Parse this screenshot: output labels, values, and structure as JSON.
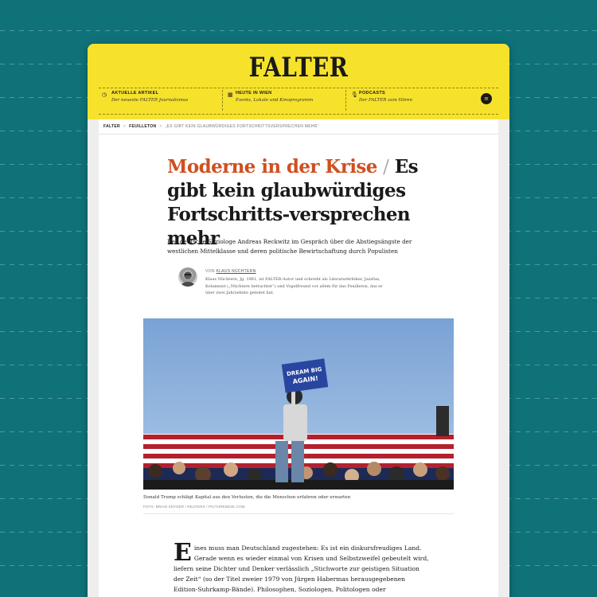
{
  "site": {
    "logo": "FALTER"
  },
  "nav": [
    {
      "icon": "clock-icon",
      "title": "Aktuelle Artikel",
      "subtitle": "Der neueste FALTER Journalismus"
    },
    {
      "icon": "calendar-icon",
      "title": "Heute in Wien",
      "subtitle": "Events, Lokale und Kinoprogramm"
    },
    {
      "icon": "microphone-icon",
      "title": "Podcasts",
      "subtitle": "Der FALTER zum Hören"
    }
  ],
  "menu_button_icon": "hamburger-icon",
  "breadcrumb": [
    "FALTER",
    "FEUILLETON",
    "„ES GIBT KEIN GLAUBWÜRDIGES FORTSCHRITTSVERSPRECHEN MEHR“"
  ],
  "article": {
    "kicker": "Moderne in der Krise",
    "title": "Es gibt kein glaubwürdiges Fortschritts-versprechen mehr",
    "lead": "Der deutsche Soziologe Andreas Reckwitz im Gespräch über die Abstiegsängste der westlichen Mittelklasse und deren politische Bewirtschaftung durch Populisten",
    "author_prefix": "VON",
    "author_name": "KLAUS NÜCHTERN",
    "author_bio": "Klaus Nüchtern, Jg. 1961, ist FALTER-Autor und schreibt als Literaturkritiker, Jazzfan, Kolumnist („Nüchtern betrachtet“) und Vogelfreund vor allem für das Feuilleton, das er über zwei Jahrzehnte geleitet hat.",
    "image_sign_line1": "DREAM BIG",
    "image_sign_line2": "AGAIN!",
    "caption": "Donald Trump schlägt Kapital aus den Verlusten, die die Menschen erfahren oder erwarten",
    "credit": "FOTO: BRIAN SNYDER / REUTERS / PICTUREDESK.COM",
    "dropcap": "E",
    "body": "ines muss man Deutschland zugestehen: Es ist ein diskursfreudiges Land. Gerade wenn es wieder einmal von Krisen und Selbstzweifel gebeutelt wird, liefern seine Dichter und Denker verlässlich „Stichworte zur geistigen Situation der Zeit“ (so der Titel zweier 1979 von Jürgen Habermas herausgegebenen Edition-Suhrkamp-Bände). Philosophen, Soziologen, Politologen oder Medienwissen-"
  },
  "colors": {
    "background": "#0f7278",
    "header": "#f6e22a",
    "kicker": "#cf4f20"
  }
}
